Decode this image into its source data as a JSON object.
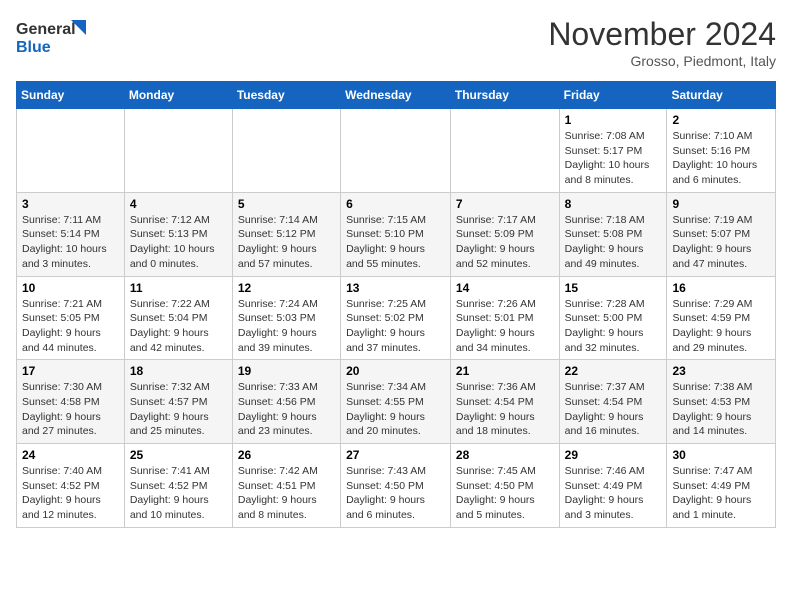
{
  "header": {
    "logo_line1": "General",
    "logo_line2": "Blue",
    "month_title": "November 2024",
    "subtitle": "Grosso, Piedmont, Italy"
  },
  "weekdays": [
    "Sunday",
    "Monday",
    "Tuesday",
    "Wednesday",
    "Thursday",
    "Friday",
    "Saturday"
  ],
  "weeks": [
    [
      {
        "day": "",
        "info": ""
      },
      {
        "day": "",
        "info": ""
      },
      {
        "day": "",
        "info": ""
      },
      {
        "day": "",
        "info": ""
      },
      {
        "day": "",
        "info": ""
      },
      {
        "day": "1",
        "info": "Sunrise: 7:08 AM\nSunset: 5:17 PM\nDaylight: 10 hours\nand 8 minutes."
      },
      {
        "day": "2",
        "info": "Sunrise: 7:10 AM\nSunset: 5:16 PM\nDaylight: 10 hours\nand 6 minutes."
      }
    ],
    [
      {
        "day": "3",
        "info": "Sunrise: 7:11 AM\nSunset: 5:14 PM\nDaylight: 10 hours\nand 3 minutes."
      },
      {
        "day": "4",
        "info": "Sunrise: 7:12 AM\nSunset: 5:13 PM\nDaylight: 10 hours\nand 0 minutes."
      },
      {
        "day": "5",
        "info": "Sunrise: 7:14 AM\nSunset: 5:12 PM\nDaylight: 9 hours\nand 57 minutes."
      },
      {
        "day": "6",
        "info": "Sunrise: 7:15 AM\nSunset: 5:10 PM\nDaylight: 9 hours\nand 55 minutes."
      },
      {
        "day": "7",
        "info": "Sunrise: 7:17 AM\nSunset: 5:09 PM\nDaylight: 9 hours\nand 52 minutes."
      },
      {
        "day": "8",
        "info": "Sunrise: 7:18 AM\nSunset: 5:08 PM\nDaylight: 9 hours\nand 49 minutes."
      },
      {
        "day": "9",
        "info": "Sunrise: 7:19 AM\nSunset: 5:07 PM\nDaylight: 9 hours\nand 47 minutes."
      }
    ],
    [
      {
        "day": "10",
        "info": "Sunrise: 7:21 AM\nSunset: 5:05 PM\nDaylight: 9 hours\nand 44 minutes."
      },
      {
        "day": "11",
        "info": "Sunrise: 7:22 AM\nSunset: 5:04 PM\nDaylight: 9 hours\nand 42 minutes."
      },
      {
        "day": "12",
        "info": "Sunrise: 7:24 AM\nSunset: 5:03 PM\nDaylight: 9 hours\nand 39 minutes."
      },
      {
        "day": "13",
        "info": "Sunrise: 7:25 AM\nSunset: 5:02 PM\nDaylight: 9 hours\nand 37 minutes."
      },
      {
        "day": "14",
        "info": "Sunrise: 7:26 AM\nSunset: 5:01 PM\nDaylight: 9 hours\nand 34 minutes."
      },
      {
        "day": "15",
        "info": "Sunrise: 7:28 AM\nSunset: 5:00 PM\nDaylight: 9 hours\nand 32 minutes."
      },
      {
        "day": "16",
        "info": "Sunrise: 7:29 AM\nSunset: 4:59 PM\nDaylight: 9 hours\nand 29 minutes."
      }
    ],
    [
      {
        "day": "17",
        "info": "Sunrise: 7:30 AM\nSunset: 4:58 PM\nDaylight: 9 hours\nand 27 minutes."
      },
      {
        "day": "18",
        "info": "Sunrise: 7:32 AM\nSunset: 4:57 PM\nDaylight: 9 hours\nand 25 minutes."
      },
      {
        "day": "19",
        "info": "Sunrise: 7:33 AM\nSunset: 4:56 PM\nDaylight: 9 hours\nand 23 minutes."
      },
      {
        "day": "20",
        "info": "Sunrise: 7:34 AM\nSunset: 4:55 PM\nDaylight: 9 hours\nand 20 minutes."
      },
      {
        "day": "21",
        "info": "Sunrise: 7:36 AM\nSunset: 4:54 PM\nDaylight: 9 hours\nand 18 minutes."
      },
      {
        "day": "22",
        "info": "Sunrise: 7:37 AM\nSunset: 4:54 PM\nDaylight: 9 hours\nand 16 minutes."
      },
      {
        "day": "23",
        "info": "Sunrise: 7:38 AM\nSunset: 4:53 PM\nDaylight: 9 hours\nand 14 minutes."
      }
    ],
    [
      {
        "day": "24",
        "info": "Sunrise: 7:40 AM\nSunset: 4:52 PM\nDaylight: 9 hours\nand 12 minutes."
      },
      {
        "day": "25",
        "info": "Sunrise: 7:41 AM\nSunset: 4:52 PM\nDaylight: 9 hours\nand 10 minutes."
      },
      {
        "day": "26",
        "info": "Sunrise: 7:42 AM\nSunset: 4:51 PM\nDaylight: 9 hours\nand 8 minutes."
      },
      {
        "day": "27",
        "info": "Sunrise: 7:43 AM\nSunset: 4:50 PM\nDaylight: 9 hours\nand 6 minutes."
      },
      {
        "day": "28",
        "info": "Sunrise: 7:45 AM\nSunset: 4:50 PM\nDaylight: 9 hours\nand 5 minutes."
      },
      {
        "day": "29",
        "info": "Sunrise: 7:46 AM\nSunset: 4:49 PM\nDaylight: 9 hours\nand 3 minutes."
      },
      {
        "day": "30",
        "info": "Sunrise: 7:47 AM\nSunset: 4:49 PM\nDaylight: 9 hours\nand 1 minute."
      }
    ]
  ]
}
